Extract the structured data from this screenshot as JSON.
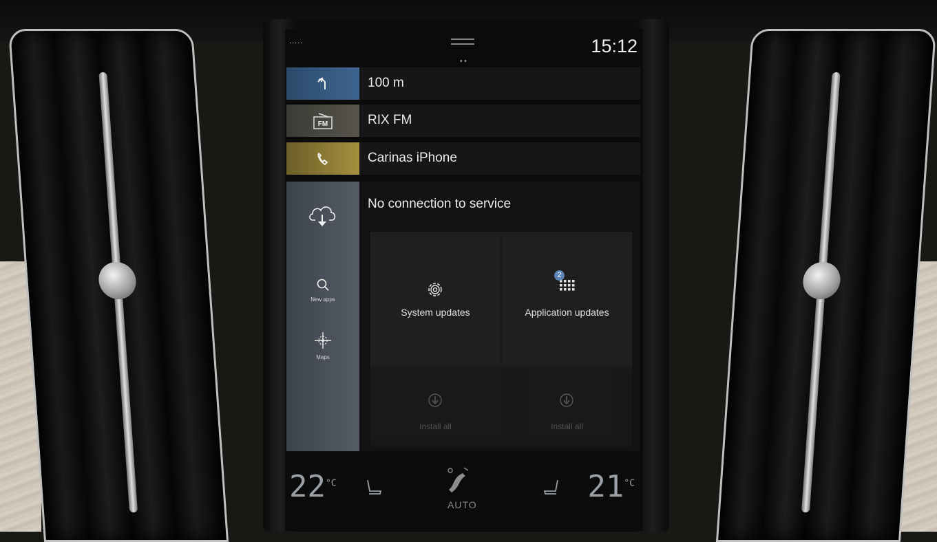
{
  "status": {
    "signal": "..... ",
    "time": "15:12"
  },
  "tiles": {
    "navigation": {
      "icon": "turn-left-arrow-icon",
      "text": "100 m"
    },
    "media": {
      "icon": "fm-radio-icon",
      "icon_text": "FM",
      "text": "RIX FM"
    },
    "phone": {
      "icon": "phone-handset-icon",
      "text": "Carinas iPhone"
    }
  },
  "app": {
    "title": "No connection to service",
    "sidebar": [
      {
        "icon": "cloud-download-icon",
        "label": ""
      },
      {
        "icon": "search-icon",
        "label": "New apps"
      },
      {
        "icon": "compass-icon",
        "label": "Maps"
      }
    ],
    "cards": {
      "system_updates": {
        "icon": "gear-icon",
        "label": "System updates"
      },
      "application_updates": {
        "icon": "app-grid-icon",
        "label": "Application updates",
        "badge": "2"
      }
    },
    "install": [
      {
        "icon": "download-icon",
        "label": "Install all"
      },
      {
        "icon": "download-icon",
        "label": "Install all"
      }
    ]
  },
  "climate": {
    "left_temp": "22",
    "right_temp": "21",
    "unit": "°C",
    "mode": "AUTO"
  },
  "colors": {
    "nav_accent": "#3e6590",
    "media_accent": "#56544b",
    "phone_accent": "#a5903f",
    "sidebar": "#4a5058"
  }
}
